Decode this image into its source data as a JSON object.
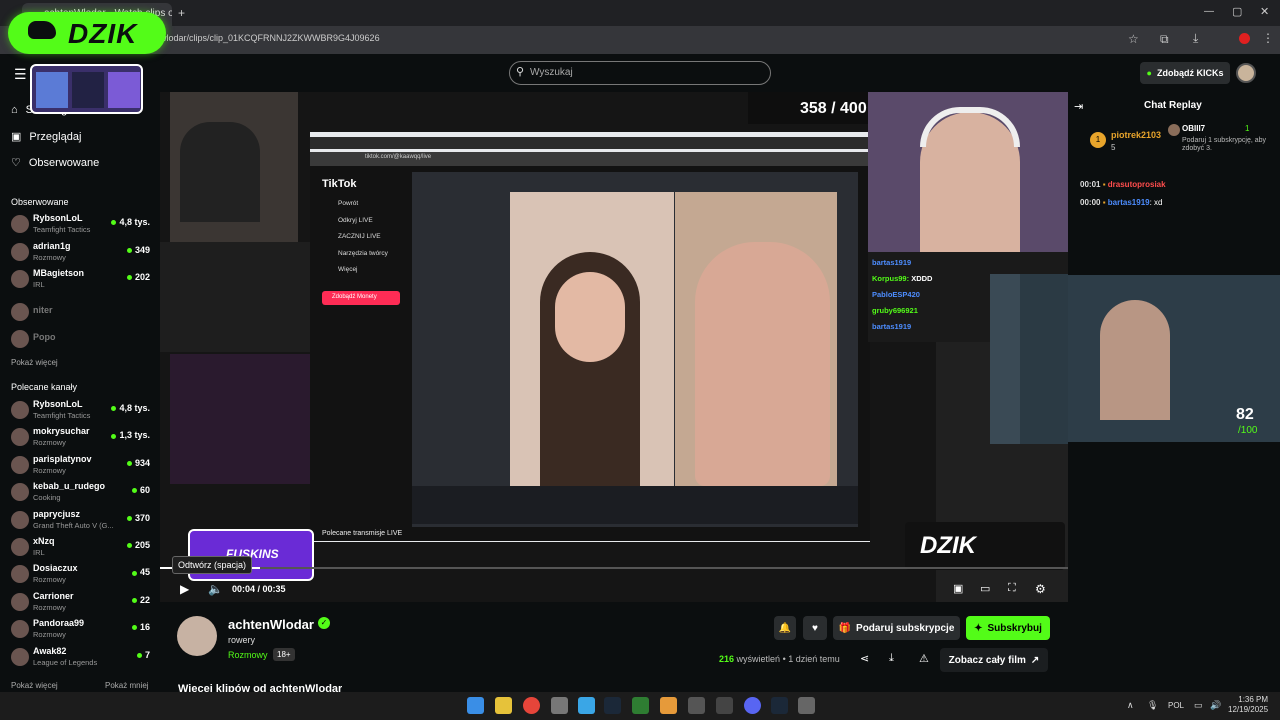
{
  "browser": {
    "tab_title": "achtenWlodar - Watch clips o...",
    "url": "wlodar/clips/clip_01KCQFRNNJ2ZKWWBR9G4J09626",
    "minimize": "—",
    "maximize": "▢",
    "close": "✕"
  },
  "brand": {
    "logo_text": "DZIK",
    "logo_watermark": "DZIK",
    "accent": "#53fc18"
  },
  "sidebar": {
    "nav": [
      {
        "label": "Strona główna",
        "icon": "home-icon"
      },
      {
        "label": "Przeglądaj",
        "icon": "compass-icon"
      },
      {
        "label": "Obserwowane",
        "icon": "heart-icon"
      }
    ],
    "followed_title": "Obserwowane",
    "followed": [
      {
        "name": "RybsonLoL",
        "category": "Teamfight Tactics",
        "viewers": "4,8 tys."
      },
      {
        "name": "adrian1g",
        "category": "Rozmowy",
        "viewers": "349"
      },
      {
        "name": "MBagietson",
        "category": "IRL",
        "viewers": "202"
      },
      {
        "name": "niter",
        "category": "",
        "viewers": ""
      },
      {
        "name": "Popo",
        "category": "",
        "viewers": ""
      }
    ],
    "show_more": "Pokaż więcej",
    "recommended_title": "Polecane kanały",
    "recommended": [
      {
        "name": "RybsonLoL",
        "category": "Teamfight Tactics",
        "viewers": "4,8 tys."
      },
      {
        "name": "mokrysuchar",
        "category": "Rozmowy",
        "viewers": "1,3 tys."
      },
      {
        "name": "parisplatynov",
        "category": "Rozmowy",
        "viewers": "934"
      },
      {
        "name": "kebab_u_rudego",
        "category": "Cooking",
        "viewers": "60"
      },
      {
        "name": "paprycjusz",
        "category": "Grand Theft Auto V (G...",
        "viewers": "370"
      },
      {
        "name": "xNzq",
        "category": "IRL",
        "viewers": "205"
      },
      {
        "name": "Dosiaczux",
        "category": "Rozmowy",
        "viewers": "45"
      },
      {
        "name": "Carrioner",
        "category": "Rozmowy",
        "viewers": "22"
      },
      {
        "name": "Pandoraa99",
        "category": "Rozmowy",
        "viewers": "16"
      },
      {
        "name": "Awak82",
        "category": "League of Legends",
        "viewers": "7"
      }
    ],
    "show_more_2": "Pokaż więcej",
    "show_less": "Pokaż mniej"
  },
  "header": {
    "search_placeholder": "Wyszukaj",
    "kicks_label": "Zdobądź KICKs"
  },
  "video": {
    "counter": "358 / 400",
    "score": "82",
    "score_total": "/100",
    "tiktok_logo": "TikTok",
    "tiktok_menu": [
      "Powrót",
      "Odkryj LIVE",
      "ZACZNIJ LIVE",
      "Narzędzia twórcy",
      "Więcej"
    ],
    "tiktok_button": "Zdobądź Monety",
    "tiktok_footer": "Polecane transmisje LIVE",
    "tiktok_url": "tiktok.com/@kaawqq/live",
    "chat_overlay": [
      {
        "user": "bartas1919",
        "text": ""
      },
      {
        "user": "Korpus99",
        "text": "XDDD"
      },
      {
        "user": "PabloESP420",
        "text": ""
      },
      {
        "user": "gruby696921",
        "text": ""
      },
      {
        "user": "bartas1919",
        "text": ""
      }
    ],
    "sponsor": "FUSKINS"
  },
  "player": {
    "tooltip": "Odtwórz (spacja)",
    "time_current": "00:04",
    "time_total": "00:35",
    "progress": 0.11
  },
  "chat": {
    "title": "Chat Replay",
    "pinned_user": "piotrek2103",
    "pinned_count": "5",
    "sub_user": "OBIII7",
    "sub_count": "1",
    "sub_text": "Podaruj 1 subskrypcję, aby zdobyć 3.",
    "messages": [
      {
        "time": "00:01",
        "user": "drasutoprosiak",
        "text": "",
        "color": "#ff4d4d"
      },
      {
        "time": "00:00",
        "user": "bartas1919",
        "text": ": xd",
        "color": "#4d8dff"
      }
    ]
  },
  "channel": {
    "name": "achtenWlodar",
    "title": "rowery",
    "category": "Rozmowy",
    "age": "18+",
    "views": "216",
    "views_label": "wyświetleń",
    "ago": "1 dzień temu",
    "gift_label": "Podaruj subskrypcje",
    "sub_label": "Subskrybuj",
    "full_label": "Zobacz cały film",
    "more_clips": "Więcej klipów od achtenWlodar"
  },
  "taskbar": {
    "lang": "POL",
    "time": "1:36 PM",
    "date": "12/19/2025"
  }
}
